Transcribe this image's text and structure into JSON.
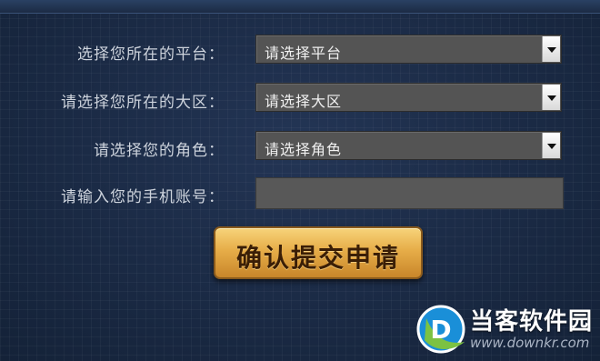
{
  "form": {
    "platform": {
      "label": "选择您所在的平台：",
      "value": "请选择平台"
    },
    "region": {
      "label": "请选择您所在的大区：",
      "value": "请选择大区"
    },
    "role": {
      "label": "请选择您的角色：",
      "value": "请选择角色"
    },
    "phone": {
      "label": "请输入您的手机账号：",
      "value": ""
    },
    "submit_label": "确认提交申请"
  },
  "watermark": {
    "title": "当客软件园",
    "url": "www.downkr.com",
    "logo_letter": "D"
  },
  "colors": {
    "background": "#1c2b44",
    "field": "#545454",
    "button": "#e6ad48",
    "logo_blue": "#1a8fd8",
    "logo_green": "#7cc242"
  }
}
